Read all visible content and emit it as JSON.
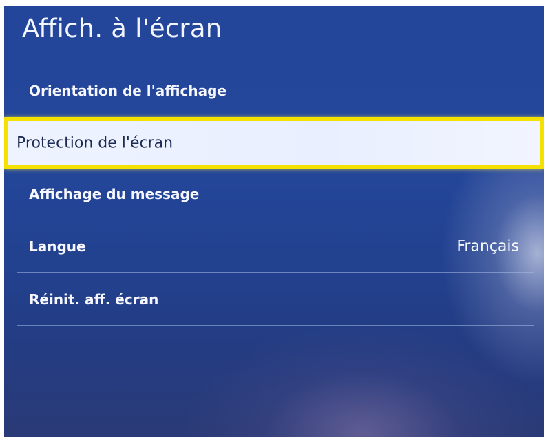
{
  "screen": {
    "title": "Affich. à l'écran"
  },
  "menu": {
    "items": [
      {
        "label": "Orientation de l'affichage",
        "value": ""
      },
      {
        "label": "Protection de l'écran",
        "value": ""
      },
      {
        "label": "Affichage du message",
        "value": ""
      },
      {
        "label": "Langue",
        "value": "Français"
      },
      {
        "label": "Réinit. aff. écran",
        "value": ""
      }
    ],
    "selected_index": 1
  },
  "colors": {
    "background": "#24469a",
    "selection_border": "#f4e100",
    "selection_fill": "#eef3ff",
    "selected_text": "#1d2a52",
    "text": "#ffffff"
  }
}
